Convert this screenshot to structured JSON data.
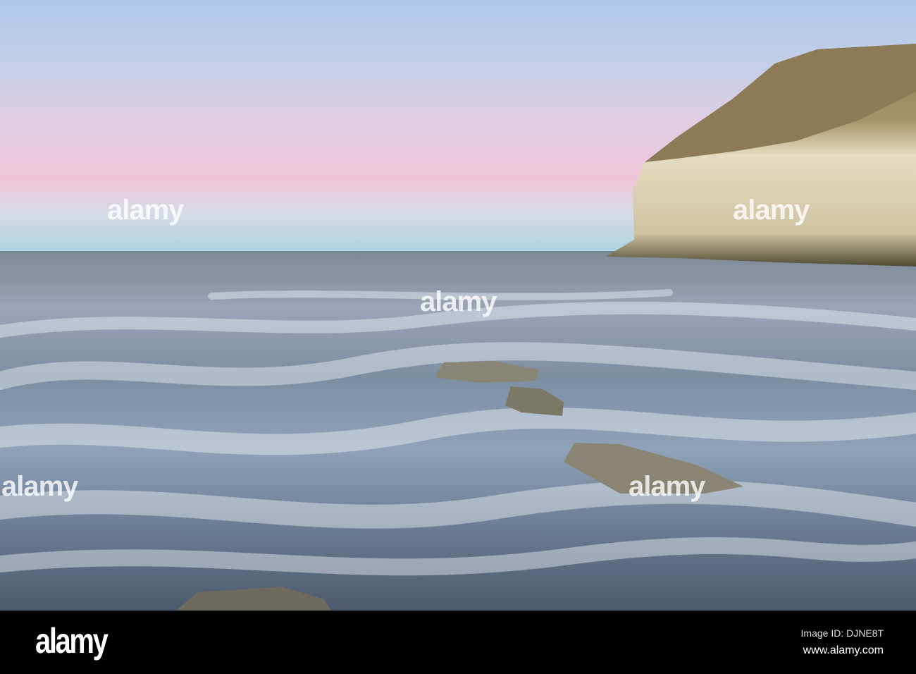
{
  "watermark": {
    "text": "alamy"
  },
  "footer": {
    "logo": "alamy",
    "image_id": "Image ID: DJNE8T",
    "url": "www.alamy.com"
  }
}
